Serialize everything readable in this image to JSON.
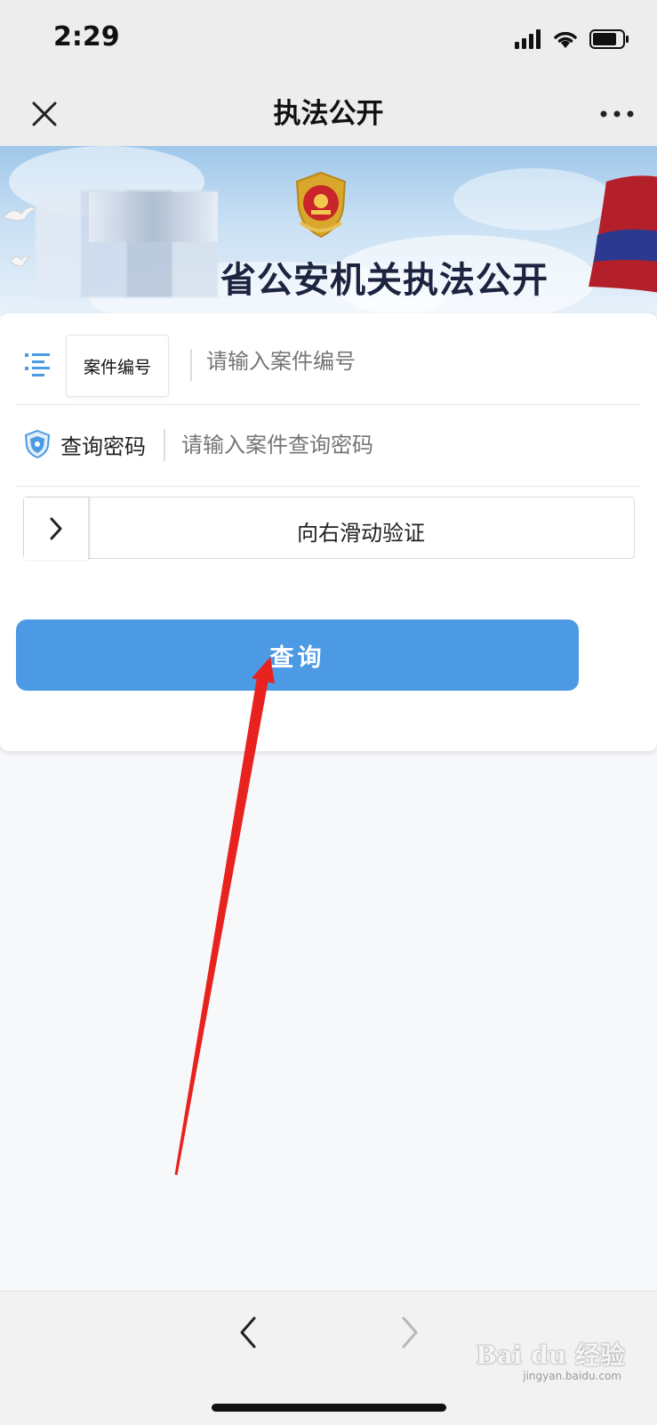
{
  "status_bar": {
    "time": "2:29"
  },
  "nav": {
    "title": "执法公开"
  },
  "banner": {
    "title": "省公安机关执法公开"
  },
  "form": {
    "case_number_tag": "案件编号",
    "case_number_placeholder": "请输入案件编号",
    "password_label": "查询密码",
    "password_placeholder": "请输入案件查询密码",
    "slider_text": "向右滑动验证",
    "query_button": "查询"
  },
  "watermark": {
    "brand": "Bai du 经验",
    "url": "jingyan.baidu.com"
  },
  "colors": {
    "accent": "#4c9ae4",
    "arrow": "#e8231f"
  }
}
